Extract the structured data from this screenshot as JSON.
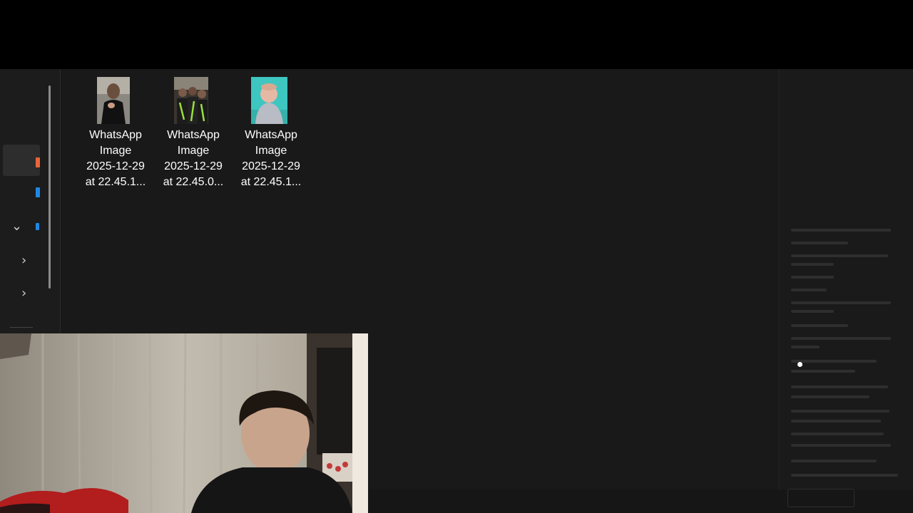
{
  "explorer": {
    "files": [
      {
        "name_lines": [
          "WhatsApp",
          "Image",
          "2025-12-29",
          "at 22.45.1..."
        ]
      },
      {
        "name_lines": [
          "WhatsApp",
          "Image",
          "2025-12-29",
          "at 22.45.0..."
        ]
      },
      {
        "name_lines": [
          "WhatsApp",
          "Image",
          "2025-12-29",
          "at 22.45.1..."
        ]
      }
    ],
    "nav_icons": [
      "home-icon",
      "gallery-icon",
      "onedrive-icon",
      "chevron-down-icon",
      "chevron-right-icon",
      "chevron-right-icon",
      "phone-icon",
      "network-icon"
    ]
  },
  "colors": {
    "background": "#191919",
    "top_bar": "#000000",
    "accent_blue": "#1e88e5",
    "accent_orange": "#e8653a",
    "accent_green": "#3ddc84"
  }
}
